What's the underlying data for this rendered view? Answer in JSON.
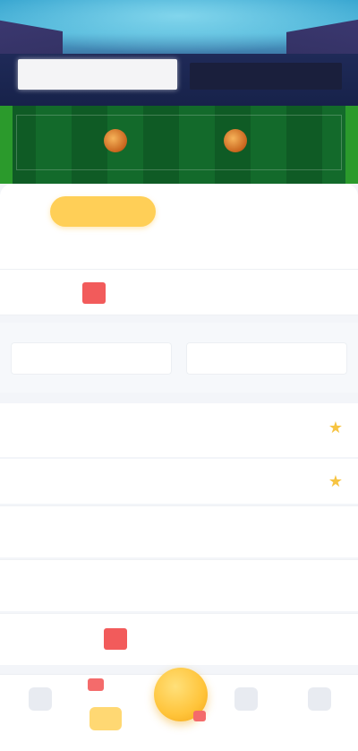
{
  "hero": {
    "team_left": "",
    "team_right": "",
    "vs": ""
  },
  "tabs": [
    {
      "label": ""
    },
    {
      "label": ""
    },
    {
      "label": ""
    },
    {
      "label": ""
    }
  ],
  "section": {
    "title": ""
  },
  "odds": {
    "items": [
      "",
      "",
      "",
      "",
      ""
    ]
  },
  "info": {
    "left": "",
    "right": ""
  },
  "promo": {
    "title": "",
    "side": ""
  },
  "list": {
    "label": "",
    "rows": [
      {
        "c1": "",
        "c2": "",
        "c3": "",
        "c4": ""
      },
      {
        "c1": "",
        "c2": "",
        "c3": "",
        "c4": ""
      },
      {
        "c1": "",
        "c2": "",
        "c3": "",
        "c4": ""
      }
    ]
  },
  "nav": {
    "items": [
      {
        "label": ""
      },
      {
        "label": ""
      },
      {
        "label": ""
      },
      {
        "label": ""
      },
      {
        "label": ""
      }
    ]
  },
  "colors": {
    "accent": "#ffcf57",
    "red": "#f25b5b",
    "pitch": "#0f5b25",
    "sky": "#3aa7d1"
  }
}
